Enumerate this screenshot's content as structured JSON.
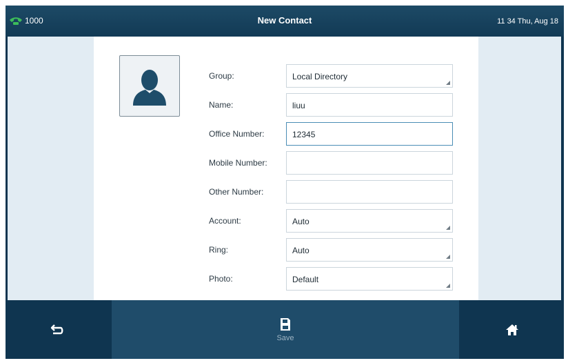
{
  "status_bar": {
    "line_icon": "phone-handset-icon",
    "line_number": "1000",
    "title": "New Contact",
    "datetime": "11 34 Thu, Aug 18"
  },
  "contact_photo": {
    "icon": "person-silhouette-icon"
  },
  "form": {
    "group": {
      "label": "Group:",
      "value": "Local Directory"
    },
    "name": {
      "label": "Name:",
      "value": "liuu"
    },
    "office_number": {
      "label": "Office Number:",
      "value": "12345"
    },
    "mobile_number": {
      "label": "Mobile Number:",
      "value": ""
    },
    "other_number": {
      "label": "Other Number:",
      "value": ""
    },
    "account": {
      "label": "Account:",
      "value": "Auto"
    },
    "ring": {
      "label": "Ring:",
      "value": "Auto"
    },
    "photo": {
      "label": "Photo:",
      "value": "Default"
    }
  },
  "softkeys": {
    "back_icon": "back-arrow-icon",
    "save_icon": "save-disk-icon",
    "save_label": "Save",
    "home_icon": "home-icon"
  },
  "colors": {
    "status_bar": "#123a55",
    "line_icon": "#3dbb5a",
    "content_background": "#e2ecf3",
    "softkey_active": "#1f4c6a"
  }
}
